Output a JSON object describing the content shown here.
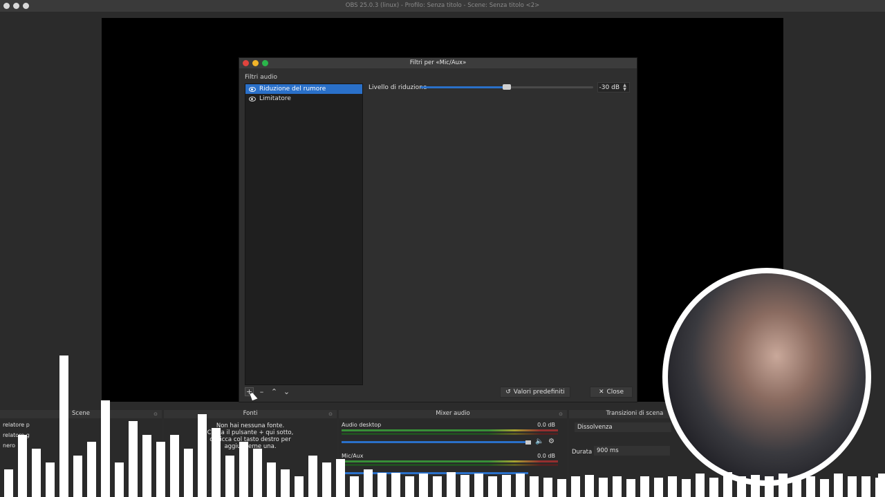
{
  "window": {
    "title": "OBS 25.0.3 (linux) - Profilo: Senza titolo - Scene: Senza titolo <2>"
  },
  "filters_dialog": {
    "title": "Filtri per «Mic/Aux»",
    "group_label": "Filtri audio",
    "filters": [
      {
        "label": "Riduzione del rumore",
        "selected": true
      },
      {
        "label": "Limitatore",
        "selected": false
      }
    ],
    "property_label": "Livello di riduzione",
    "slider_fraction": 0.5,
    "value_text": "-30 dB",
    "defaults_button": "Valori predefiniti",
    "close_button": "Close",
    "colors": {
      "accent": "#2a70c9",
      "close": "#e0443e",
      "minimize": "#f0b429",
      "maximize": "#2ab54b"
    }
  },
  "docks": {
    "scene": {
      "title": "Scene",
      "items": [
        "relatore p",
        "relatore g",
        "nero"
      ]
    },
    "sources": {
      "title": "Fonti",
      "empty_lines": [
        "Non hai nessuna fonte.",
        "Clicca il pulsante + qui sotto,",
        "o clicca col tasto destro per",
        "aggiungerne una."
      ]
    },
    "mixer": {
      "title": "Mixer audio",
      "channels": [
        {
          "name": "Audio desktop",
          "db": "0.0 dB"
        },
        {
          "name": "Mic/Aux",
          "db": "0.0 dB"
        }
      ]
    },
    "transitions": {
      "title": "Transizioni di scena",
      "selected": "Dissolvenza",
      "duration_label": "Durata",
      "duration_value": "900 ms"
    }
  }
}
